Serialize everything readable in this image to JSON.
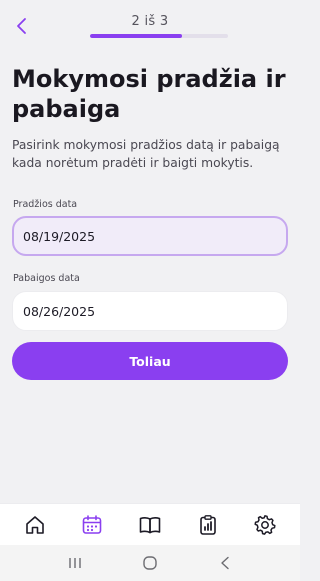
{
  "header": {
    "step_label": "2 iš 3",
    "progress": 0.67,
    "back_icon": "chevron-left-icon"
  },
  "main": {
    "title": "Mokymosi pradžia ir pabaiga",
    "subtitle": "Pasirink mokymosi pradžios datą ir pabaigą kada norėtum pradėti ir baigti mokytis.",
    "start_date": {
      "label": "Pradžios data",
      "value": "08/19/2025"
    },
    "end_date": {
      "label": "Pabaigos data",
      "value": "08/26/2025"
    },
    "next_button": "Toliau"
  },
  "bottom_nav": {
    "items": [
      {
        "icon": "home-icon",
        "active": false
      },
      {
        "icon": "calendar-icon",
        "active": true
      },
      {
        "icon": "book-icon",
        "active": false
      },
      {
        "icon": "clipboard-chart-icon",
        "active": false
      },
      {
        "icon": "gear-icon",
        "active": false
      }
    ]
  },
  "system_nav": {
    "items": [
      "recents-icon",
      "home-circle-icon",
      "back-arrow-icon"
    ]
  },
  "colors": {
    "accent": "#8a3ff0",
    "background": "#f1f1f3",
    "focused_field_border": "#c6a8ef"
  }
}
